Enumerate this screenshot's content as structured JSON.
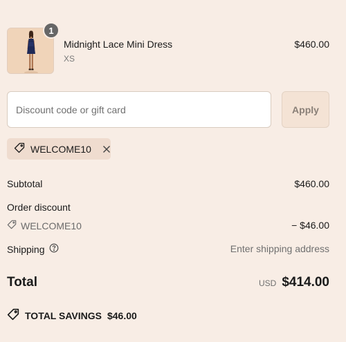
{
  "product": {
    "quantity_badge": "1",
    "name": "Midnight Lace Mini Dress",
    "variant": "XS",
    "price": "$460.00",
    "image_icon": "dress-photo"
  },
  "discount": {
    "placeholder": "Discount code or gift card",
    "value": "",
    "apply_label": "Apply",
    "applied_code": "WELCOME10"
  },
  "summary": {
    "subtotal_label": "Subtotal",
    "subtotal_value": "$460.00",
    "order_discount_label": "Order discount",
    "order_discount_code": "WELCOME10",
    "order_discount_value": "− $46.00",
    "shipping_label": "Shipping",
    "shipping_value": "Enter shipping address",
    "total_label": "Total",
    "total_currency": "USD",
    "total_value": "$414.00",
    "savings_label": "TOTAL SAVINGS",
    "savings_value": "$46.00"
  },
  "colors": {
    "background": "#f8ede5",
    "chip": "#efdccf",
    "badge": "#666666"
  }
}
